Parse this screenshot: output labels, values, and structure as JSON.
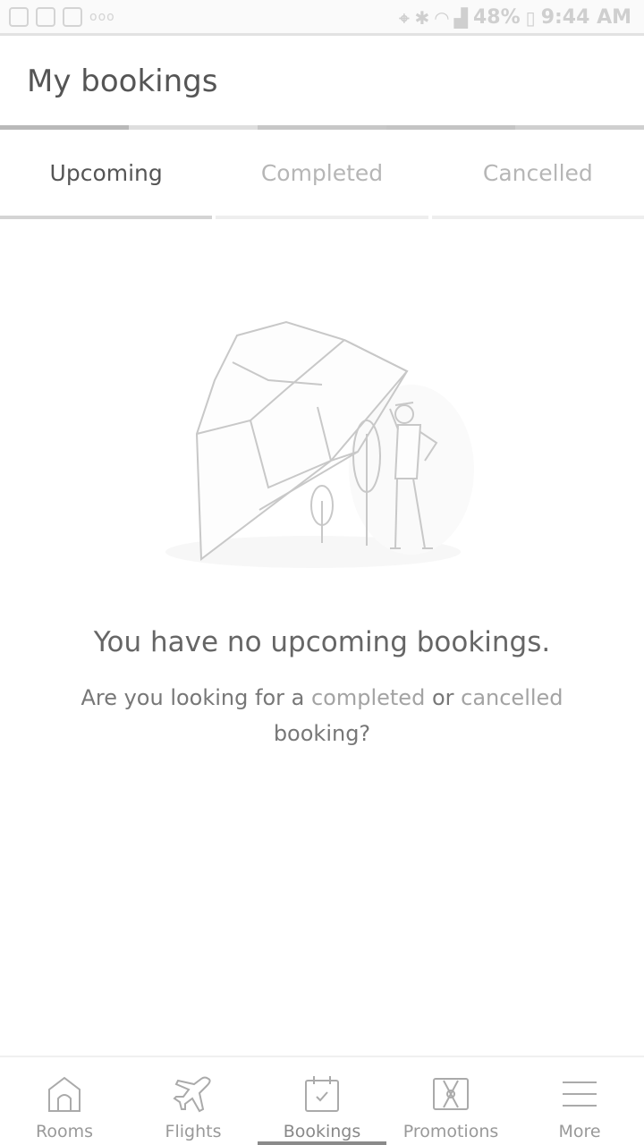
{
  "status_bar": {
    "dots": "ooo",
    "battery": "48%",
    "time": "9:44 AM"
  },
  "header": {
    "title": "My bookings"
  },
  "tabs": [
    {
      "label": "Upcoming",
      "active": true
    },
    {
      "label": "Completed",
      "active": false
    },
    {
      "label": "Cancelled",
      "active": false
    }
  ],
  "empty_state": {
    "title": "You have no upcoming bookings.",
    "prefix": "Are you looking for a ",
    "completed_link": "completed",
    "middle": " or ",
    "cancelled_link": "cancelled",
    "suffix": " booking?"
  },
  "bottom_nav": {
    "items": [
      {
        "label": "Rooms",
        "icon": "home-icon"
      },
      {
        "label": "Flights",
        "icon": "airplane-icon"
      },
      {
        "label": "Bookings",
        "icon": "calendar-check-icon",
        "active": true
      },
      {
        "label": "Promotions",
        "icon": "ticket-icon"
      },
      {
        "label": "More",
        "icon": "menu-icon"
      }
    ]
  }
}
